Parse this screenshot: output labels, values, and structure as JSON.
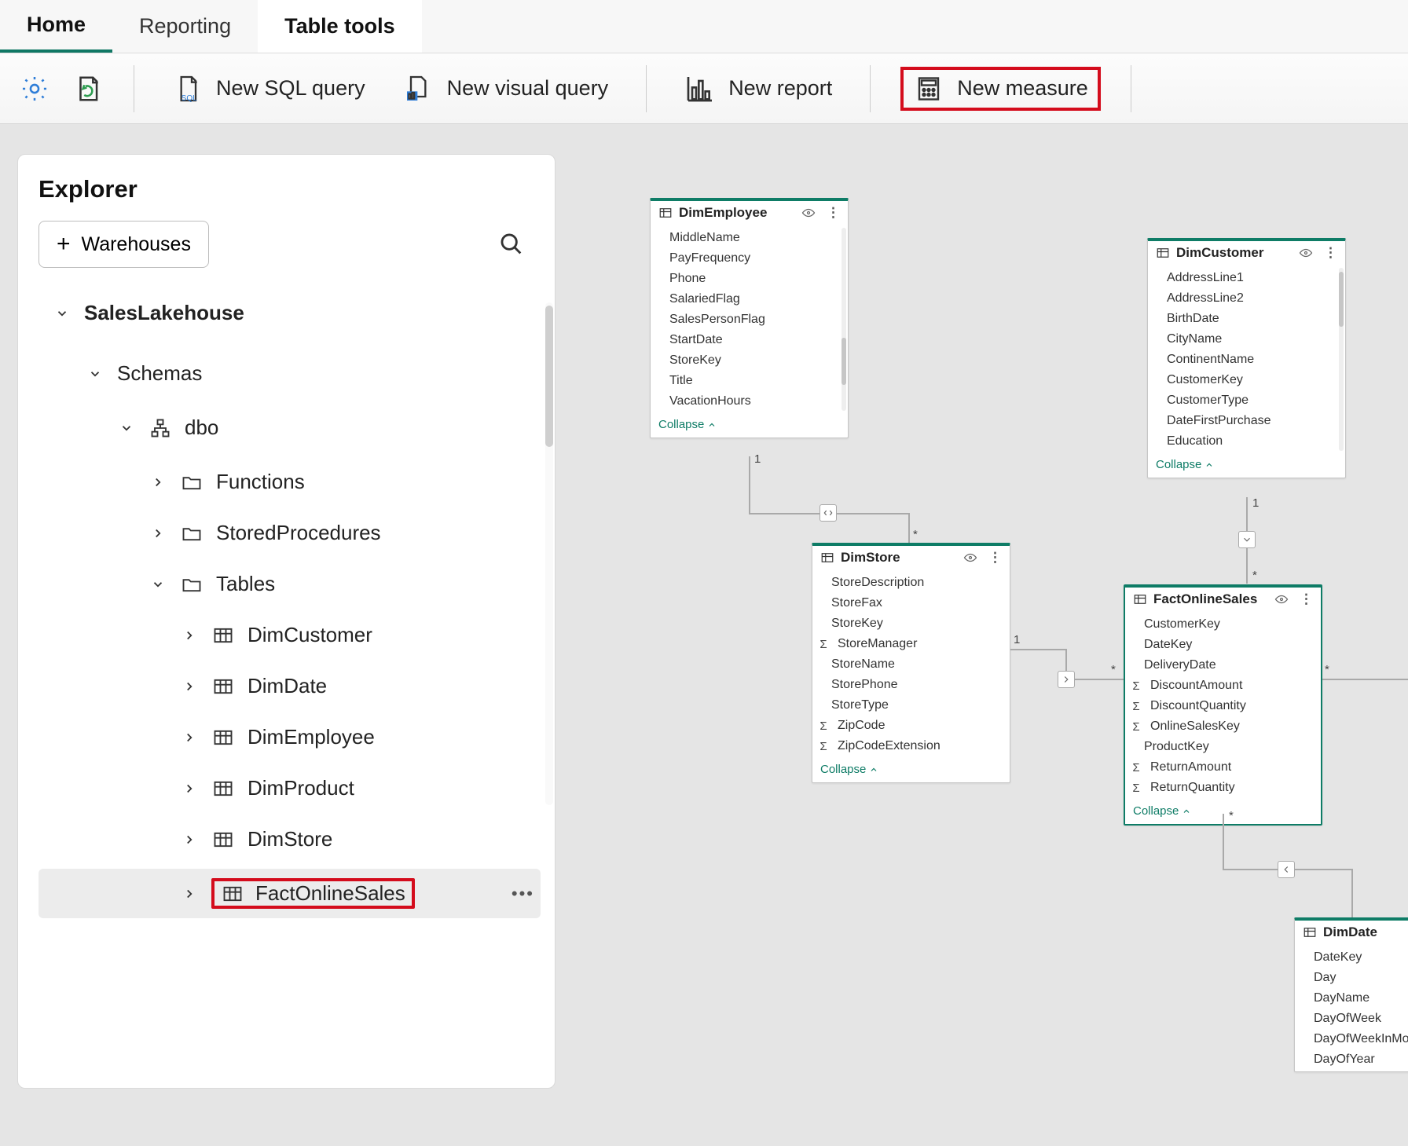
{
  "tabs": {
    "home": "Home",
    "reporting": "Reporting",
    "tableTools": "Table tools"
  },
  "toolbar": {
    "newSql": "New SQL query",
    "newVisual": "New visual query",
    "newReport": "New report",
    "newMeasure": "New measure"
  },
  "explorer": {
    "title": "Explorer",
    "warehousesBtn": "Warehouses",
    "root": "SalesLakehouse",
    "schemas": "Schemas",
    "dbo": "dbo",
    "functions": "Functions",
    "storedProcs": "StoredProcedures",
    "tables": "Tables",
    "tableList": {
      "dimCustomer": "DimCustomer",
      "dimDate": "DimDate",
      "dimEmployee": "DimEmployee",
      "dimProduct": "DimProduct",
      "dimStore": "DimStore",
      "factOnlineSales": "FactOnlineSales"
    }
  },
  "diagram": {
    "collapseLabel": "Collapse",
    "dimEmployee": {
      "title": "DimEmployee",
      "cols": [
        "MiddleName",
        "PayFrequency",
        "Phone",
        "SalariedFlag",
        "SalesPersonFlag",
        "StartDate",
        "StoreKey",
        "Title",
        "VacationHours"
      ]
    },
    "dimCustomer": {
      "title": "DimCustomer",
      "cols": [
        "AddressLine1",
        "AddressLine2",
        "BirthDate",
        "CityName",
        "ContinentName",
        "CustomerKey",
        "CustomerType",
        "DateFirstPurchase",
        "Education"
      ]
    },
    "dimStore": {
      "title": "DimStore",
      "cols": [
        "StoreDescription",
        "StoreFax",
        "StoreKey",
        "StoreManager",
        "StoreName",
        "StorePhone",
        "StoreType",
        "ZipCode",
        "ZipCodeExtension"
      ],
      "sigmaIdx": [
        3,
        7,
        8
      ]
    },
    "factOnlineSales": {
      "title": "FactOnlineSales",
      "cols": [
        "CustomerKey",
        "DateKey",
        "DeliveryDate",
        "DiscountAmount",
        "DiscountQuantity",
        "OnlineSalesKey",
        "ProductKey",
        "ReturnAmount",
        "ReturnQuantity"
      ],
      "sigmaIdx": [
        3,
        4,
        5,
        7,
        8
      ]
    },
    "dimDate": {
      "title": "DimDate",
      "cols": [
        "DateKey",
        "Day",
        "DayName",
        "DayOfWeek",
        "DayOfWeekInMon",
        "DayOfYear"
      ]
    }
  }
}
